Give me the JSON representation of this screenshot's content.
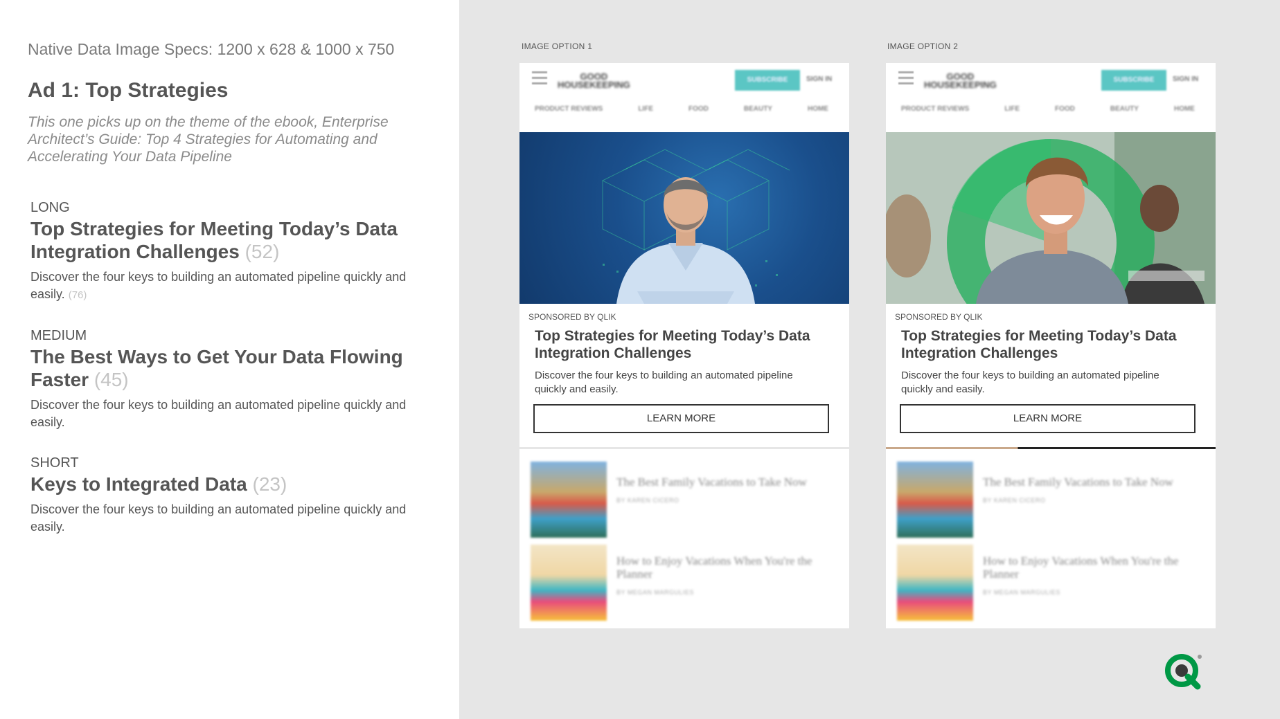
{
  "left": {
    "specs": "Native Data Image Specs: 1200 x 628 & 1000 x 750",
    "ad_title": "Ad 1: Top Strategies",
    "ad_description": "This one picks up on the theme of the ebook, Enterprise Architect’s Guide: Top 4 Strategies for Automating and Accelerating Your Data Pipeline",
    "sections": [
      {
        "label": "LONG",
        "headline": "Top Strategies for Meeting Today’s Data Integration Challenges",
        "headline_count": "(52)",
        "body": "Discover the four keys to building an automated pipeline quickly and easily.",
        "body_count": "(76)"
      },
      {
        "label": "MEDIUM",
        "headline": "The Best Ways to Get Your Data Flowing Faster",
        "headline_count": "(45)",
        "body": "Discover the four keys to building an automated pipeline quickly and easily.",
        "body_count": ""
      },
      {
        "label": "SHORT",
        "headline": "Keys to Integrated Data",
        "headline_count": "(23)",
        "body": "Discover the four keys to building an automated pipeline quickly and easily.",
        "body_count": ""
      }
    ]
  },
  "options": [
    {
      "label": "IMAGE OPTION 1",
      "logo_line1": "GOOD",
      "logo_line2": "HOUSEKEEPING",
      "subscribe": "SUBSCRIBE",
      "sign_in": "SIGN IN",
      "nav": [
        "PRODUCT REVIEWS",
        "LIFE",
        "FOOD",
        "BEAUTY",
        "HOME"
      ],
      "sponsored": "SPONSORED BY QLIK",
      "title": "Top Strategies for Meeting Today’s Data Integration Challenges",
      "description": "Discover the four keys to building an automated pipeline quickly and easily.",
      "cta": "LEARN MORE",
      "feed": [
        {
          "title": "The Best Family Vacations to Take Now",
          "byline": "BY KAREN CICERO"
        },
        {
          "title": "How to Enjoy Vacations When You're the Planner",
          "byline": "BY MEGAN MARGULIES"
        }
      ]
    },
    {
      "label": "IMAGE OPTION 2",
      "logo_line1": "GOOD",
      "logo_line2": "HOUSEKEEPING",
      "subscribe": "SUBSCRIBE",
      "sign_in": "SIGN IN",
      "nav": [
        "PRODUCT REVIEWS",
        "LIFE",
        "FOOD",
        "BEAUTY",
        "HOME"
      ],
      "sponsored": "SPONSORED BY QLIK",
      "title": "Top Strategies for Meeting Today’s Data Integration Challenges",
      "description": "Discover the four keys to building an automated pipeline quickly and easily.",
      "cta": "LEARN MORE",
      "feed": [
        {
          "title": "The Best Family Vacations to Take Now",
          "byline": "BY KAREN CICERO"
        },
        {
          "title": "How to Enjoy Vacations When You're the Planner",
          "byline": "BY MEGAN MARGULIES"
        }
      ]
    }
  ],
  "colors": {
    "accent_teal": "#5bc6c4",
    "qlik_green": "#009845",
    "hero1_blue": "#1a4f8c"
  },
  "icons": {
    "menu": "hamburger-menu-icon",
    "brand": "qlik-logo-icon"
  }
}
